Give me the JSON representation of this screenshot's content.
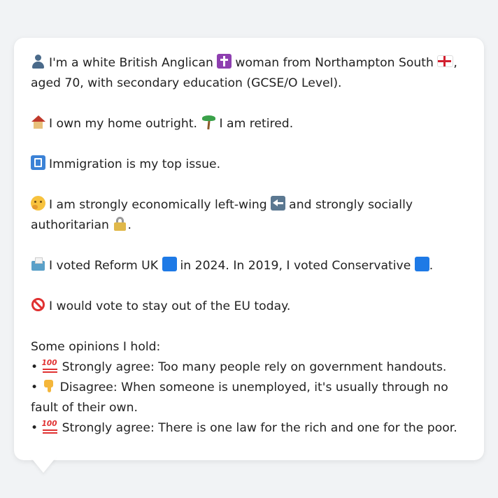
{
  "profile": {
    "intro": {
      "icon": "person-icon",
      "text_a": "I'm a white British Anglican",
      "icon_religion": "cross-icon",
      "text_b": "woman from Northampton South",
      "icon_flag": "england-flag-icon",
      "text_c": ", aged 70, with secondary education (GCSE/O Level)."
    },
    "housing": {
      "icon_home": "house-icon",
      "text_home": "I own my home outright.",
      "icon_work": "palm-icon",
      "text_work": "I am retired."
    },
    "issue": {
      "icon": "passport-control-icon",
      "text": "Immigration is my top issue."
    },
    "ideology": {
      "icon": "thinking-face-icon",
      "text_a": "I am strongly economically left-wing",
      "icon_left": "left-arrow-icon",
      "text_b": "and strongly socially authoritarian",
      "icon_lock": "lock-icon",
      "text_end": "."
    },
    "votes": {
      "icon": "ballot-box-icon",
      "text_a": "I voted Reform UK",
      "icon_reform": "blue-square-icon",
      "text_b": "in 2024. In 2019, I voted Conservative",
      "icon_con": "blue-square-icon",
      "text_end": "."
    },
    "eu": {
      "icon": "prohibited-icon",
      "text": "I would vote to stay out of the EU today."
    },
    "opinions": {
      "heading": "Some opinions I hold:",
      "items": [
        {
          "bullet": "•",
          "icon": "hundred-points-icon",
          "text": "Strongly agree: Too many people rely on government handouts."
        },
        {
          "bullet": "•",
          "icon": "thumbs-down-icon",
          "text": "Disagree: When someone is unemployed, it's usually through no fault of their own."
        },
        {
          "bullet": "•",
          "icon": "hundred-points-icon",
          "text": "Strongly agree: There is one law for the rich and one for the poor."
        }
      ]
    }
  },
  "colors": {
    "background": "#f1f3f5",
    "bubble": "#ffffff",
    "text": "#222222"
  }
}
